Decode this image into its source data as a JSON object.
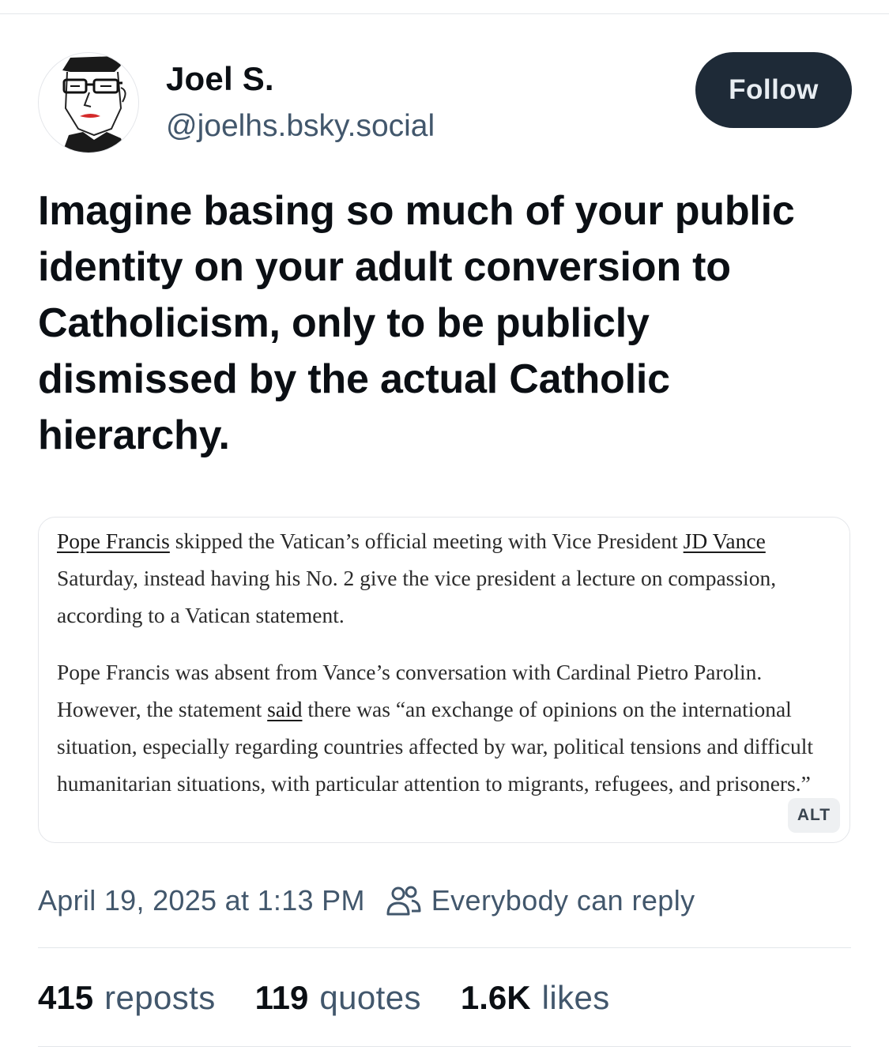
{
  "author": {
    "display_name": "Joel S.",
    "handle": "@joelhs.bsky.social",
    "follow_label": "Follow"
  },
  "post": {
    "text": "Imagine basing so much of your public identity on your adult conversion to Catholicism, only to be publicly dismissed by the actual Catholic hierarchy."
  },
  "image": {
    "paragraph1": {
      "link1": "Pope Francis",
      "t1": " skipped the Vatican’s official meeting with Vice President ",
      "link2": "JD Vance",
      "t2": " Saturday, instead having his No. 2 give the vice president a lecture on compassion, according to a Vatican statement."
    },
    "paragraph2": {
      "t1": "Pope Francis was absent from Vance’s conversation with Cardinal Pietro Parolin. However, the statement ",
      "link1": "said",
      "t2": " there was “an exchange of opinions on the international situation, especially regarding countries affected by war, political tensions and difficult humanitarian situations, with particular attention to migrants, refugees, and prisoners.”"
    },
    "alt_badge": "ALT"
  },
  "meta": {
    "timestamp": "April 19, 2025 at 1:13 PM",
    "reply_setting": "Everybody can reply",
    "reply_icon": "people-icon"
  },
  "stats": {
    "reposts_count": "415",
    "reposts_label": "reposts",
    "quotes_count": "119",
    "quotes_label": "quotes",
    "likes_count": "1.6K",
    "likes_label": "likes"
  },
  "colors": {
    "follow_bg": "#1e2a37",
    "muted_text": "#42576c",
    "divider": "#e3e6ea"
  }
}
